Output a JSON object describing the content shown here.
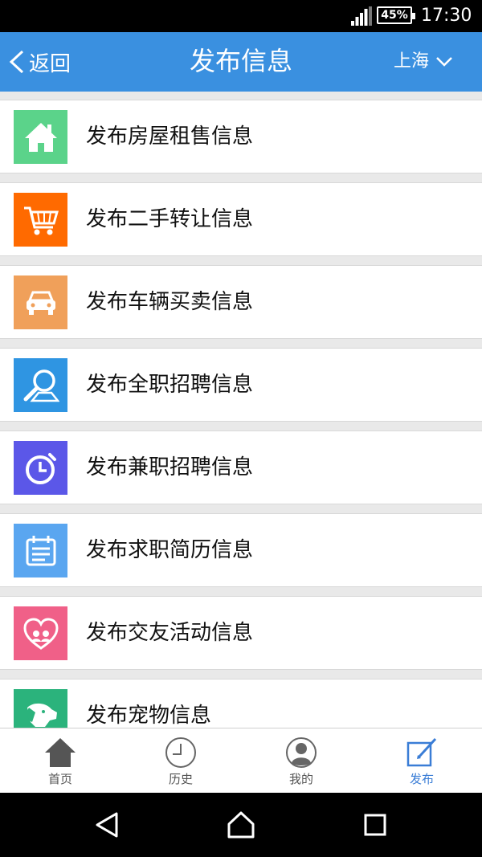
{
  "status_bar": {
    "battery": "45%",
    "time": "17:30"
  },
  "header": {
    "back_label": "返回",
    "title": "发布信息",
    "city": "上海"
  },
  "items": [
    {
      "label": "发布房屋租售信息",
      "icon": "house-icon",
      "color": "#5bd38a"
    },
    {
      "label": "发布二手转让信息",
      "icon": "cart-icon",
      "color": "#ff6a00"
    },
    {
      "label": "发布车辆买卖信息",
      "icon": "car-icon",
      "color": "#f0a05a"
    },
    {
      "label": "发布全职招聘信息",
      "icon": "magnifier-icon",
      "color": "#2f95e2"
    },
    {
      "label": "发布兼职招聘信息",
      "icon": "stopwatch-icon",
      "color": "#5b57e8"
    },
    {
      "label": "发布求职简历信息",
      "icon": "calendar-icon",
      "color": "#5aa6f0"
    },
    {
      "label": "发布交友活动信息",
      "icon": "heart-couple-icon",
      "color": "#f06088"
    },
    {
      "label": "发布宠物信息",
      "icon": "dog-icon",
      "color": "#2bb37c"
    }
  ],
  "tabs": [
    {
      "label": "首页",
      "icon": "home-icon"
    },
    {
      "label": "历史",
      "icon": "clock-icon"
    },
    {
      "label": "我的",
      "icon": "user-icon"
    },
    {
      "label": "发布",
      "icon": "edit-icon",
      "active": true
    }
  ],
  "nav": [
    "back-icon",
    "home-icon",
    "recents-icon"
  ]
}
